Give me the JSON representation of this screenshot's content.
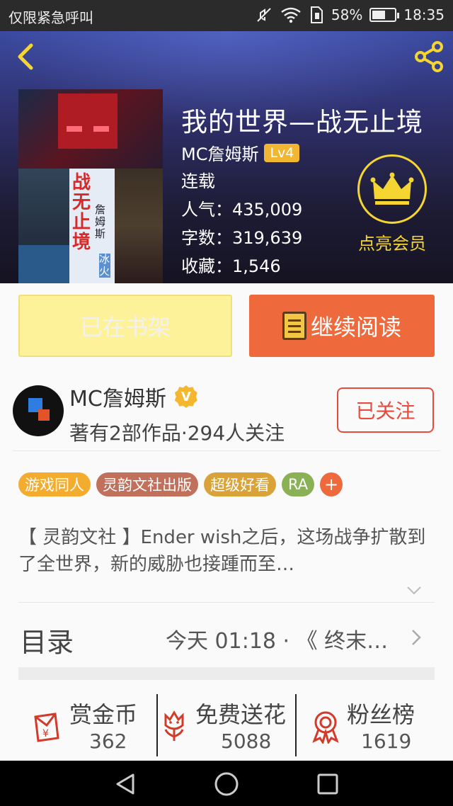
{
  "status_bar": {
    "carrier_text": "仅限紧急呼叫",
    "battery_percent": "58%",
    "battery_level": 0.58,
    "time": "18:35"
  },
  "header": {
    "back_icon": "back-arrow-icon",
    "share_icon": "share-icon"
  },
  "book": {
    "title": "我的世界—战无止境",
    "cover_title_text": "战无止境",
    "cover_author_text": "詹姆斯",
    "cover_pen_text": "冰火",
    "author": "MC詹姆斯",
    "level": "Lv4",
    "status": "连载",
    "popularity": "人气：435,009",
    "word_count": "字数：319,639",
    "favorites": "收藏：1,546"
  },
  "vip": {
    "icon": "crown-icon",
    "label": "点亮会员",
    "color": "#f5d531"
  },
  "actions": {
    "shelf_label": "已在书架",
    "read_label": "继续阅读",
    "read_color": "#ee6a3c",
    "shelf_color": "#fdf29a"
  },
  "author_section": {
    "name": "MC詹姆斯",
    "verified_icon": "verified-badge-icon",
    "verified_glyph": "V",
    "works_summary": "著有2部作品·294人关注",
    "follow_label": "已关注",
    "follow_color": "#e84a3b"
  },
  "tags": [
    {
      "label": "游戏同人",
      "color": "#f4ac2e"
    },
    {
      "label": "灵韵文社出版",
      "color": "#c0705b"
    },
    {
      "label": "超级好看",
      "color": "#d9a33a"
    },
    {
      "label": "RA",
      "color": "#8bb157"
    },
    {
      "label": "+",
      "color": "#ee6a3c"
    }
  ],
  "intro": {
    "text": "【 灵韵文社 】Ender wish之后，这场战争扩散到了全世界，新的威胁也接踵而至…"
  },
  "toc": {
    "label": "目录",
    "latest": "今天 01:18 · 《 终末…"
  },
  "stats": [
    {
      "label": "赏金币",
      "value": "362",
      "icon": "red-envelope-icon"
    },
    {
      "label": "免费送花",
      "value": "5088",
      "icon": "flower-icon"
    },
    {
      "label": "粉丝榜",
      "value": "1619",
      "icon": "medal-icon"
    }
  ],
  "nav": {
    "back": "nav-back-icon",
    "home": "nav-home-icon",
    "recent": "nav-recent-icon"
  }
}
